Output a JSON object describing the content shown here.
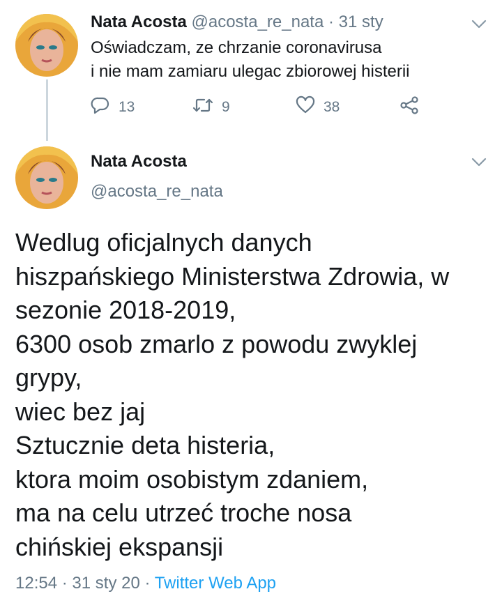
{
  "colors": {
    "text": "#14171a",
    "secondary": "#657786",
    "link": "#1da1f2",
    "thread_line": "#ccd6dd"
  },
  "tweet1": {
    "name": "Nata Acosta",
    "handle": "@acosta_re_nata",
    "separator": "·",
    "date": "31 sty",
    "text_lines": [
      "Oświadczam, ze chrzanie coronavirusa",
      "i nie mam zamiaru ulegac zbiorowej histerii"
    ],
    "reply_count": "13",
    "retweet_count": "9",
    "like_count": "38",
    "icons": [
      "reply-icon",
      "retweet-icon",
      "like-icon",
      "share-icon",
      "chevron-down-icon"
    ]
  },
  "tweet2": {
    "name": "Nata Acosta",
    "handle": "@acosta_re_nata",
    "text_lines": [
      "Wedlug oficjalnych danych",
      "hiszpańskiego Ministerstwa Zdrowia, w",
      "sezonie 2018-2019,",
      "6300 osob zmarlo z powodu zwyklej",
      "grypy,",
      "wiec bez jaj",
      "Sztucznie deta histeria,",
      "ktora moim osobistym zdaniem,",
      "ma na celu utrzeć troche nosa",
      "chińskiej ekspansji"
    ],
    "time": "12:54",
    "separator": "·",
    "date": "31 sty 20",
    "source": "Twitter Web App"
  }
}
